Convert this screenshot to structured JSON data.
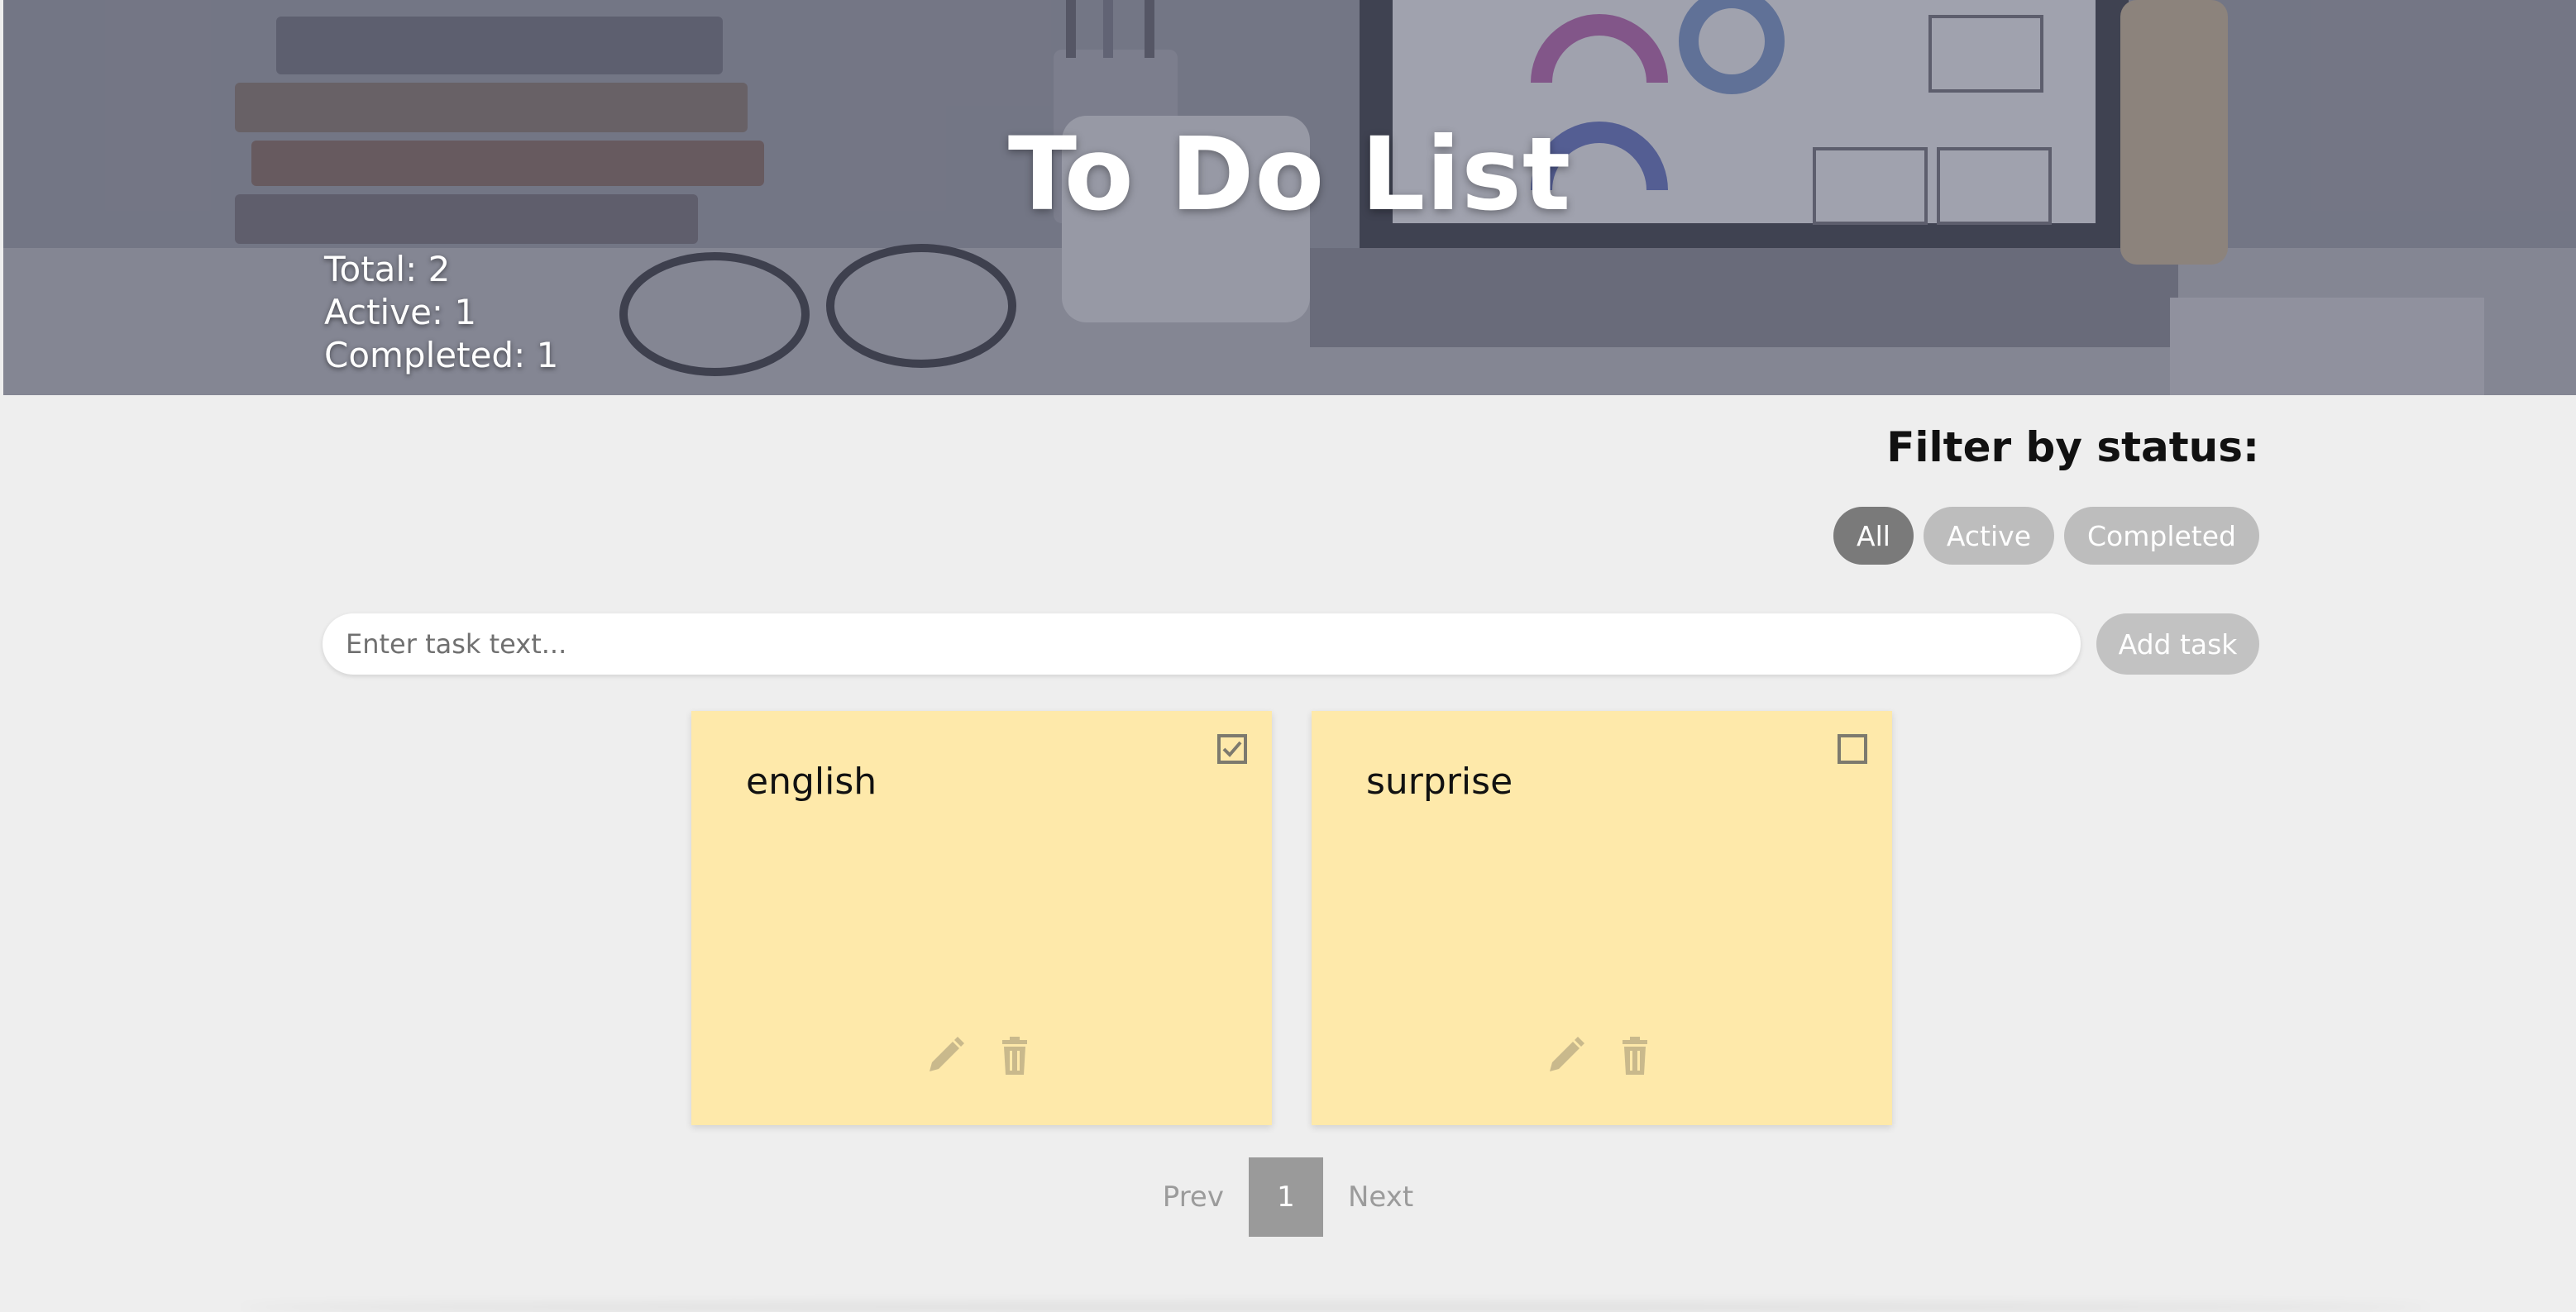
{
  "header": {
    "title": "To Do List",
    "stats": {
      "total_label": "Total: 2",
      "active_label": "Active: 1",
      "completed_label": "Completed: 1"
    }
  },
  "filter": {
    "label": "Filter by status:",
    "options": [
      "All",
      "Active",
      "Completed"
    ],
    "selected": "All"
  },
  "add_task": {
    "placeholder": "Enter task text...",
    "button_label": "Add task"
  },
  "tasks": [
    {
      "text": "english",
      "completed": true
    },
    {
      "text": "surprise",
      "completed": false
    }
  ],
  "pagination": {
    "prev_label": "Prev",
    "current_page": "1",
    "next_label": "Next"
  },
  "colors": {
    "card": "#fee9aa",
    "pill_active": "#7a7a7a",
    "pill_inactive": "#bdbdbd",
    "background": "#eeeeee"
  },
  "icons": {
    "task_actions": [
      "pencil-icon",
      "trash-icon"
    ],
    "checkbox_checked": "check-icon"
  }
}
